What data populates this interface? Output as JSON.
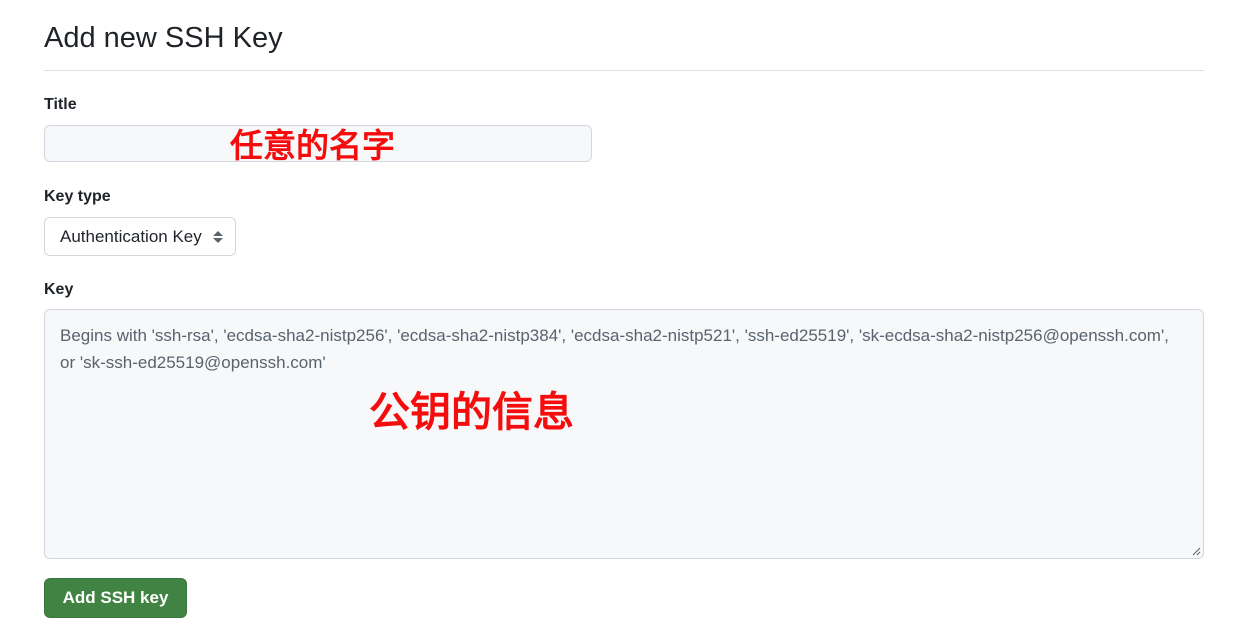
{
  "page": {
    "title": "Add new SSH Key"
  },
  "form": {
    "title_field": {
      "label": "Title",
      "value": "",
      "placeholder": ""
    },
    "key_type": {
      "label": "Key type",
      "selected": "Authentication Key"
    },
    "key_field": {
      "label": "Key",
      "value": "",
      "placeholder": "Begins with 'ssh-rsa', 'ecdsa-sha2-nistp256', 'ecdsa-sha2-nistp384', 'ecdsa-sha2-nistp521', 'ssh-ed25519', 'sk-ecdsa-sha2-nistp256@openssh.com', or 'sk-ssh-ed25519@openssh.com'"
    },
    "submit_label": "Add SSH key"
  },
  "annotations": {
    "title_note": "任意的名字",
    "key_note": "公钥的信息"
  },
  "colors": {
    "button_bg": "#418342",
    "annotation": "#f50c0c",
    "input_bg": "#f6f8fa",
    "border": "#d0d7de"
  }
}
